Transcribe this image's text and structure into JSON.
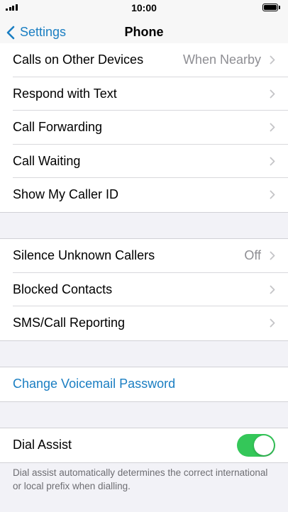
{
  "status_bar": {
    "time": "10:00",
    "battery_level": 1.0
  },
  "nav": {
    "back_label": "Settings",
    "title": "Phone"
  },
  "group1": {
    "rows": [
      {
        "label": "Calls on Other Devices",
        "value": "When Nearby"
      },
      {
        "label": "Respond with Text"
      },
      {
        "label": "Call Forwarding"
      },
      {
        "label": "Call Waiting"
      },
      {
        "label": "Show My Caller ID"
      }
    ]
  },
  "group2": {
    "rows": [
      {
        "label": "Silence Unknown Callers",
        "value": "Off"
      },
      {
        "label": "Blocked Contacts"
      },
      {
        "label": "SMS/Call Reporting"
      }
    ]
  },
  "voicemail": {
    "label": "Change Voicemail Password"
  },
  "dial_assist": {
    "label": "Dial Assist",
    "enabled": true,
    "description": "Dial assist automatically determines the correct international or local prefix when dialling."
  },
  "colors": {
    "accent": "#1a7ec2",
    "toggle_on": "#34c759",
    "background": "#f2f2f7"
  }
}
